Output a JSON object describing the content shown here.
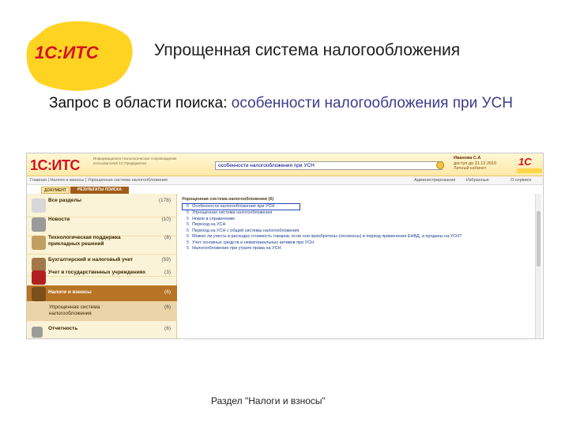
{
  "slide": {
    "logo_text": "1С:ИТС",
    "title": "Упрощенная система налогообложения",
    "query_label": "Запрос в области поиска:",
    "query_value": "особенности налогообложения при УСН",
    "caption": "Раздел \"Налоги и взносы\""
  },
  "app": {
    "logo": "1С:ИТС",
    "tagline": "Информационно-технологическое сопровождение пользователей 1С:Предприятия",
    "search_value": "особенности налогообложения при УСН",
    "user": {
      "name": "Иванова С.А",
      "date": "доступ до 31.12.2016",
      "link": "Личный кабинет"
    },
    "right_logo": "1С",
    "nav": {
      "breadcrumb": "Главная  |  Налоги и взносы  |  Упрощенная система налогообложения",
      "admin_link": "Администрирование",
      "favorites_link": "Избранные",
      "about_link": "О сервисе"
    },
    "tabs": {
      "document": "ДОКУМЕНТ",
      "results": "РЕЗУЛЬТАТЫ ПОИСКА"
    },
    "sidebar": [
      {
        "label": "Все разделы",
        "count": "(178)"
      },
      {
        "label": "Новости",
        "count": "(10)"
      },
      {
        "label": "Технологическая поддержка прикладных решений",
        "count": "(8)"
      },
      {
        "label": "Бухгалтерский и налоговый учет",
        "count": "(59)"
      },
      {
        "label": "Учет в государственных учреждениях",
        "count": "(3)"
      },
      {
        "label": "Налоги и взносы",
        "count": "(6)"
      },
      {
        "label": "Упрощенная система налогообложения",
        "count": "(6)"
      },
      {
        "label": "Отчетность",
        "count": "(6)"
      }
    ],
    "results": {
      "heading": "Упрощенная система налогообложения (6)",
      "items": [
        {
          "num": "5",
          "text": "Особенности налогообложения при УСН"
        },
        {
          "num": "5",
          "text": "Упрощенная система налогообложения"
        },
        {
          "num": "5",
          "text": "Новое в справочнике"
        },
        {
          "num": "5",
          "text": "Переход на УСН"
        },
        {
          "num": "5",
          "text": "Переход на УСН с общей системы налогообложения"
        },
        {
          "num": "5",
          "text": "Можно ли учесть в расходах стоимость товаров, если они приобретены (оплачены) в период применения ЕНВД, а проданы на УСН?"
        },
        {
          "num": "5",
          "text": "Учет основных средств и нематериальных активов при УСН"
        },
        {
          "num": "5",
          "text": "Налогообложение при утрате права на УСН"
        }
      ]
    }
  },
  "colors": {
    "brand_red": "#d4111f",
    "logo_yellow": "#ffd321",
    "sidebar_active": "#b87425",
    "highlight_border": "#2245b8"
  }
}
